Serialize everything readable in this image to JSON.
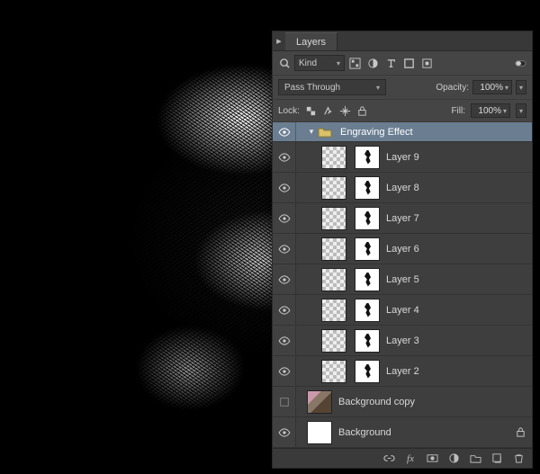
{
  "panel": {
    "title": "Layers",
    "filter": {
      "kind_label": "Kind"
    },
    "blend": {
      "mode": "Pass Through",
      "opacity_label": "Opacity:",
      "opacity_value": "100%"
    },
    "lock": {
      "label": "Lock:",
      "fill_label": "Fill:",
      "fill_value": "100%"
    },
    "group": {
      "name": "Engraving Effect"
    },
    "layers": [
      {
        "name": "Layer 9",
        "visible": true
      },
      {
        "name": "Layer 8",
        "visible": true
      },
      {
        "name": "Layer 7",
        "visible": true
      },
      {
        "name": "Layer 6",
        "visible": true
      },
      {
        "name": "Layer 5",
        "visible": true
      },
      {
        "name": "Layer 4",
        "visible": true
      },
      {
        "name": "Layer 3",
        "visible": true
      },
      {
        "name": "Layer 2",
        "visible": true
      }
    ],
    "bgcopy": {
      "name": "Background copy",
      "visible": false
    },
    "background": {
      "name": "Background",
      "visible": true
    }
  }
}
